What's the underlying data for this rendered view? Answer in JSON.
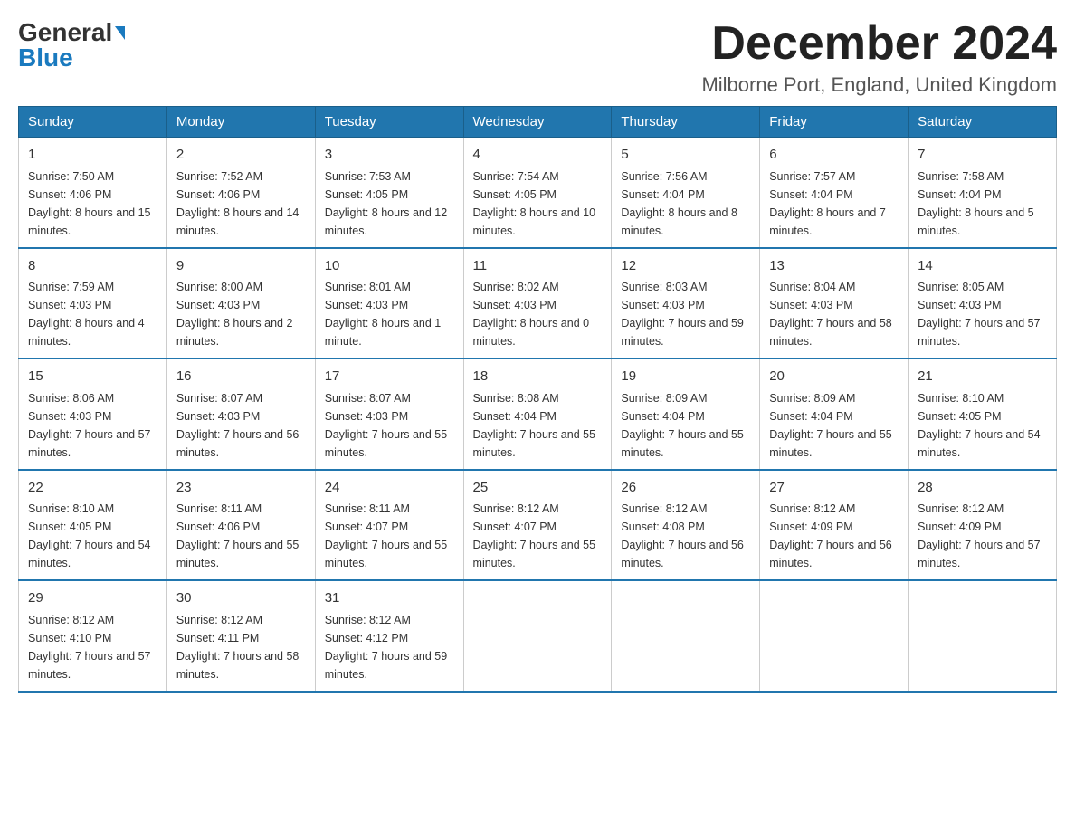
{
  "logo": {
    "general": "General",
    "blue": "Blue"
  },
  "header": {
    "month": "December 2024",
    "location": "Milborne Port, England, United Kingdom"
  },
  "days_of_week": [
    "Sunday",
    "Monday",
    "Tuesday",
    "Wednesday",
    "Thursday",
    "Friday",
    "Saturday"
  ],
  "weeks": [
    [
      {
        "day": "1",
        "sunrise": "7:50 AM",
        "sunset": "4:06 PM",
        "daylight": "8 hours and 15 minutes."
      },
      {
        "day": "2",
        "sunrise": "7:52 AM",
        "sunset": "4:06 PM",
        "daylight": "8 hours and 14 minutes."
      },
      {
        "day": "3",
        "sunrise": "7:53 AM",
        "sunset": "4:05 PM",
        "daylight": "8 hours and 12 minutes."
      },
      {
        "day": "4",
        "sunrise": "7:54 AM",
        "sunset": "4:05 PM",
        "daylight": "8 hours and 10 minutes."
      },
      {
        "day": "5",
        "sunrise": "7:56 AM",
        "sunset": "4:04 PM",
        "daylight": "8 hours and 8 minutes."
      },
      {
        "day": "6",
        "sunrise": "7:57 AM",
        "sunset": "4:04 PM",
        "daylight": "8 hours and 7 minutes."
      },
      {
        "day": "7",
        "sunrise": "7:58 AM",
        "sunset": "4:04 PM",
        "daylight": "8 hours and 5 minutes."
      }
    ],
    [
      {
        "day": "8",
        "sunrise": "7:59 AM",
        "sunset": "4:03 PM",
        "daylight": "8 hours and 4 minutes."
      },
      {
        "day": "9",
        "sunrise": "8:00 AM",
        "sunset": "4:03 PM",
        "daylight": "8 hours and 2 minutes."
      },
      {
        "day": "10",
        "sunrise": "8:01 AM",
        "sunset": "4:03 PM",
        "daylight": "8 hours and 1 minute."
      },
      {
        "day": "11",
        "sunrise": "8:02 AM",
        "sunset": "4:03 PM",
        "daylight": "8 hours and 0 minutes."
      },
      {
        "day": "12",
        "sunrise": "8:03 AM",
        "sunset": "4:03 PM",
        "daylight": "7 hours and 59 minutes."
      },
      {
        "day": "13",
        "sunrise": "8:04 AM",
        "sunset": "4:03 PM",
        "daylight": "7 hours and 58 minutes."
      },
      {
        "day": "14",
        "sunrise": "8:05 AM",
        "sunset": "4:03 PM",
        "daylight": "7 hours and 57 minutes."
      }
    ],
    [
      {
        "day": "15",
        "sunrise": "8:06 AM",
        "sunset": "4:03 PM",
        "daylight": "7 hours and 57 minutes."
      },
      {
        "day": "16",
        "sunrise": "8:07 AM",
        "sunset": "4:03 PM",
        "daylight": "7 hours and 56 minutes."
      },
      {
        "day": "17",
        "sunrise": "8:07 AM",
        "sunset": "4:03 PM",
        "daylight": "7 hours and 55 minutes."
      },
      {
        "day": "18",
        "sunrise": "8:08 AM",
        "sunset": "4:04 PM",
        "daylight": "7 hours and 55 minutes."
      },
      {
        "day": "19",
        "sunrise": "8:09 AM",
        "sunset": "4:04 PM",
        "daylight": "7 hours and 55 minutes."
      },
      {
        "day": "20",
        "sunrise": "8:09 AM",
        "sunset": "4:04 PM",
        "daylight": "7 hours and 55 minutes."
      },
      {
        "day": "21",
        "sunrise": "8:10 AM",
        "sunset": "4:05 PM",
        "daylight": "7 hours and 54 minutes."
      }
    ],
    [
      {
        "day": "22",
        "sunrise": "8:10 AM",
        "sunset": "4:05 PM",
        "daylight": "7 hours and 54 minutes."
      },
      {
        "day": "23",
        "sunrise": "8:11 AM",
        "sunset": "4:06 PM",
        "daylight": "7 hours and 55 minutes."
      },
      {
        "day": "24",
        "sunrise": "8:11 AM",
        "sunset": "4:07 PM",
        "daylight": "7 hours and 55 minutes."
      },
      {
        "day": "25",
        "sunrise": "8:12 AM",
        "sunset": "4:07 PM",
        "daylight": "7 hours and 55 minutes."
      },
      {
        "day": "26",
        "sunrise": "8:12 AM",
        "sunset": "4:08 PM",
        "daylight": "7 hours and 56 minutes."
      },
      {
        "day": "27",
        "sunrise": "8:12 AM",
        "sunset": "4:09 PM",
        "daylight": "7 hours and 56 minutes."
      },
      {
        "day": "28",
        "sunrise": "8:12 AM",
        "sunset": "4:09 PM",
        "daylight": "7 hours and 57 minutes."
      }
    ],
    [
      {
        "day": "29",
        "sunrise": "8:12 AM",
        "sunset": "4:10 PM",
        "daylight": "7 hours and 57 minutes."
      },
      {
        "day": "30",
        "sunrise": "8:12 AM",
        "sunset": "4:11 PM",
        "daylight": "7 hours and 58 minutes."
      },
      {
        "day": "31",
        "sunrise": "8:12 AM",
        "sunset": "4:12 PM",
        "daylight": "7 hours and 59 minutes."
      },
      null,
      null,
      null,
      null
    ]
  ]
}
